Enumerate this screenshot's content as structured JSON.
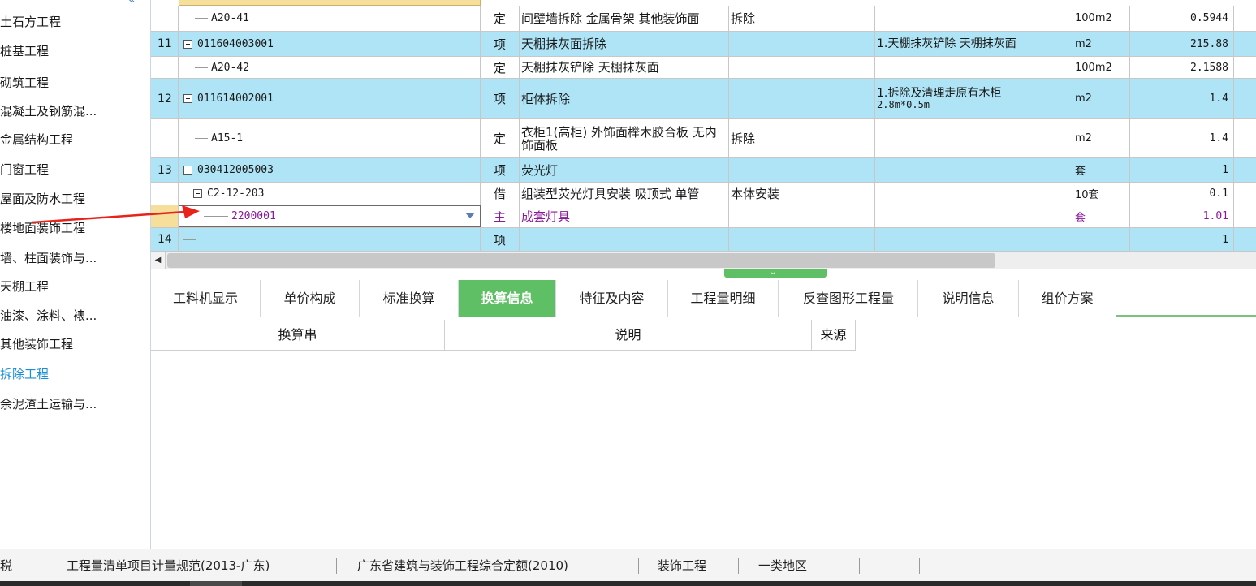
{
  "sidebar": {
    "items": [
      {
        "label": "土石方工程",
        "active": false
      },
      {
        "label": "桩基工程",
        "active": false
      },
      {
        "label": "砌筑工程",
        "active": false
      },
      {
        "label": "混凝土及钢筋混...",
        "active": false
      },
      {
        "label": "金属结构工程",
        "active": false
      },
      {
        "label": "门窗工程",
        "active": false
      },
      {
        "label": "屋面及防水工程",
        "active": false
      },
      {
        "label": "楼地面装饰工程",
        "active": false
      },
      {
        "label": "墙、柱面装饰与...",
        "active": false
      },
      {
        "label": "天棚工程",
        "active": false
      },
      {
        "label": "油漆、涂料、裱...",
        "active": false
      },
      {
        "label": "其他装饰工程",
        "active": false
      },
      {
        "label": "拆除工程",
        "active": true
      },
      {
        "label": "余泥渣土运输与...",
        "active": false
      }
    ]
  },
  "grid": {
    "rows": [
      {
        "no": "",
        "code": "A20-41",
        "level": 2,
        "expand": false,
        "type": "定",
        "name": "间壁墙拆除 金属骨架 其他装饰面",
        "desc": "拆除",
        "feat": "",
        "feat2": "",
        "unit": "100m2",
        "qty": "0.5944",
        "style": "white"
      },
      {
        "no": "11",
        "code": "011604003001",
        "level": 0,
        "expand": true,
        "type": "项",
        "name": "天棚抹灰面拆除",
        "desc": "",
        "feat": "1.天棚抹灰铲除 天棚抹灰面",
        "feat2": "",
        "unit": "m2",
        "qty": "215.88",
        "style": "blue"
      },
      {
        "no": "",
        "code": "A20-42",
        "level": 2,
        "expand": false,
        "type": "定",
        "name": "天棚抹灰铲除 天棚抹灰面",
        "desc": "",
        "feat": "",
        "feat2": "",
        "unit": "100m2",
        "qty": "2.1588",
        "style": "white"
      },
      {
        "no": "12",
        "code": "011614002001",
        "level": 0,
        "expand": true,
        "type": "项",
        "name": "柜体拆除",
        "desc": "",
        "feat": "1.拆除及清理走原有木柜",
        "feat2": "2.8m*0.5m",
        "unit": "m2",
        "qty": "1.4",
        "style": "blue"
      },
      {
        "no": "",
        "code": "A15-1",
        "level": 2,
        "expand": false,
        "type": "定",
        "name": "衣柜1(高柜) 外饰面榉木胶合板 无内饰面板",
        "desc": "拆除",
        "feat": "",
        "feat2": "",
        "unit": "m2",
        "qty": "1.4",
        "style": "white"
      },
      {
        "no": "13",
        "code": "030412005003",
        "level": 0,
        "expand": true,
        "type": "项",
        "name": "荧光灯",
        "desc": "",
        "feat": "",
        "feat2": "",
        "unit": "套",
        "qty": "1",
        "style": "blue"
      },
      {
        "no": "",
        "code": "C2-12-203",
        "level": 1,
        "expand": true,
        "type": "借",
        "name": "组装型荧光灯具安装 吸顶式 单管",
        "desc": "本体安装",
        "feat": "",
        "feat2": "",
        "unit": "10套",
        "qty": "0.1",
        "style": "white"
      },
      {
        "no": "",
        "code": "2200001",
        "level": 3,
        "expand": false,
        "type": "主",
        "name": "成套灯具",
        "desc": "",
        "feat": "",
        "feat2": "",
        "unit": "套",
        "qty": "1.01",
        "style": "selected"
      },
      {
        "no": "14",
        "code": "",
        "level": 0,
        "expand": false,
        "type": "项",
        "name": "",
        "desc": "",
        "feat": "",
        "feat2": "",
        "unit": "",
        "qty": "1",
        "style": "blue"
      }
    ]
  },
  "tabs": [
    {
      "label": "工料机显示",
      "active": false
    },
    {
      "label": "单价构成",
      "active": false
    },
    {
      "label": "标准换算",
      "active": false
    },
    {
      "label": "换算信息",
      "active": true
    },
    {
      "label": "特征及内容",
      "active": false
    },
    {
      "label": "工程量明细",
      "active": false
    },
    {
      "label": "反查图形工程量",
      "active": false
    },
    {
      "label": "说明信息",
      "active": false
    },
    {
      "label": "组价方案",
      "active": false
    }
  ],
  "subtable": {
    "headers": [
      "换算串",
      "说明",
      "来源"
    ]
  },
  "statusbar": {
    "items": [
      "税",
      "工程量清单项目计量规范(2013-广东)",
      "广东省建筑与装饰工程综合定额(2010)",
      "装饰工程",
      "一类地区"
    ]
  },
  "colors": {
    "row_blue": "#aee4f5",
    "tab_active": "#5fbf64",
    "sidebar_active": "#1a8fd6",
    "main_material": "#8a1a9a",
    "arrow": "#e8231b"
  }
}
